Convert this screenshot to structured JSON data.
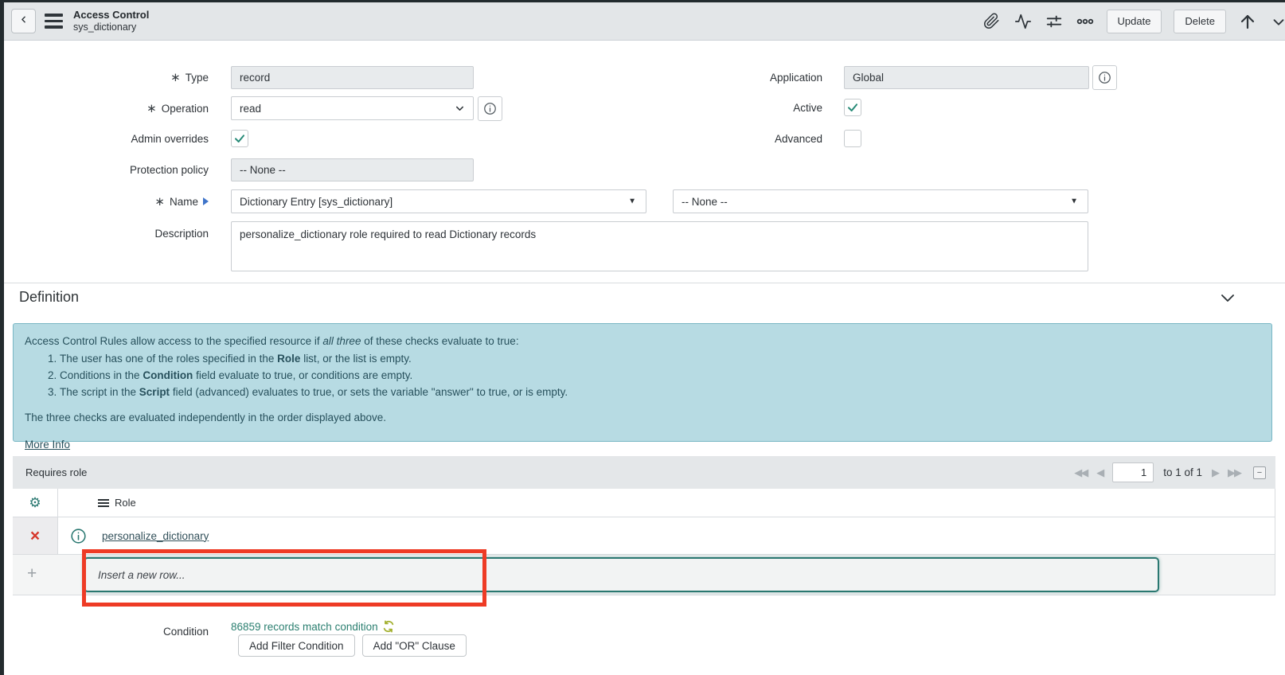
{
  "header": {
    "title": "Access Control",
    "subtitle": "sys_dictionary",
    "buttons": {
      "update": "Update",
      "delete": "Delete"
    }
  },
  "form": {
    "type": {
      "label": "Type",
      "value": "record"
    },
    "operation": {
      "label": "Operation",
      "value": "read"
    },
    "admin_overrides": {
      "label": "Admin overrides",
      "checked": true
    },
    "protection_policy": {
      "label": "Protection policy",
      "value": "-- None --"
    },
    "name": {
      "label": "Name",
      "value": "Dictionary Entry [sys_dictionary]",
      "secondary_value": "-- None --"
    },
    "description": {
      "label": "Description",
      "value": "personalize_dictionary role required to read Dictionary records"
    },
    "application": {
      "label": "Application",
      "value": "Global"
    },
    "active": {
      "label": "Active",
      "checked": true
    },
    "advanced": {
      "label": "Advanced",
      "checked": false
    }
  },
  "definition": {
    "title": "Definition"
  },
  "info_box": {
    "intro_prefix": "Access Control Rules allow access to the specified resource if ",
    "intro_italic": "all three",
    "intro_suffix": " of these checks evaluate to true:",
    "items": [
      {
        "prefix": "The user has one of the roles specified in the ",
        "bold": "Role",
        "suffix": " list, or the list is empty."
      },
      {
        "prefix": "Conditions in the ",
        "bold": "Condition",
        "suffix": " field evaluate to true, or conditions are empty."
      },
      {
        "prefix": "The script in the ",
        "bold": "Script",
        "suffix": " field (advanced) evaluates to true, or sets the variable \"answer\" to true, or is empty."
      }
    ],
    "footer": "The three checks are evaluated independently in the order displayed above.",
    "more_info": "More Info"
  },
  "requires_role": {
    "title": "Requires role",
    "pagination": {
      "page": "1",
      "range_text": "to 1 of 1"
    },
    "role_column": "Role",
    "rows": [
      {
        "role": "personalize_dictionary"
      }
    ],
    "insert_placeholder": "Insert a new row..."
  },
  "condition": {
    "label": "Condition",
    "match_text": "86859 records match condition",
    "add_filter_label": "Add Filter Condition",
    "add_or_label": "Add \"OR\" Clause"
  },
  "colors": {
    "accent_teal": "#2a7871",
    "annotation_red": "#ee3b25",
    "info_box_bg": "#b7dbe3",
    "link_teal": "#2b7f70",
    "delete_red": "#d6372c"
  }
}
